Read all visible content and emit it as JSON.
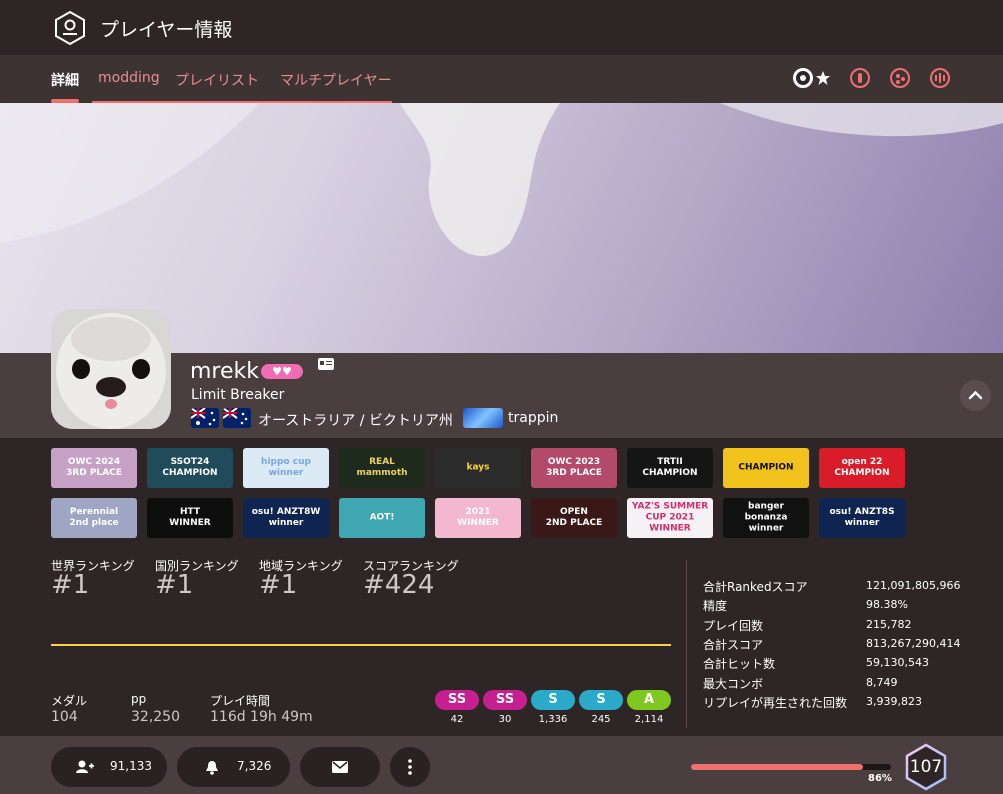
{
  "header": {
    "title": "プレイヤー情報"
  },
  "tabs": [
    {
      "label": "詳細",
      "active": true
    },
    {
      "label": "modding"
    },
    {
      "label": "プレイリスト"
    },
    {
      "label": "マルチプレイヤー"
    }
  ],
  "modes": [
    "osu-standard-icon",
    "taiko-icon",
    "catch-icon",
    "mania-icon"
  ],
  "user": {
    "username": "mrekk",
    "supporter": "♥♥",
    "title": "Limit Breaker",
    "country": "オーストラリア / ビクトリア州",
    "team": "trappin"
  },
  "badges": [
    {
      "text": "OWC 2024\n3RD PLACE",
      "bg": "#c7a0c6",
      "fg": "#fff"
    },
    {
      "text": "SSOT24\nCHAMPION",
      "bg": "#1f4b5a",
      "fg": "#fff"
    },
    {
      "text": "hippo cup\nwinner",
      "bg": "#dbeaf5",
      "fg": "#7aa7d8"
    },
    {
      "text": "REAL\nmammoth",
      "bg": "#1d2a1c",
      "fg": "#e9d26b"
    },
    {
      "text": "kays",
      "bg": "#2b2b2b",
      "fg": "#ffd43a"
    },
    {
      "text": "OWC 2023\n3RD PLACE",
      "bg": "#b44a6a",
      "fg": "#fff"
    },
    {
      "text": "TRTII\nCHAMPION",
      "bg": "#151515",
      "fg": "#fff"
    },
    {
      "text": "CHAMPION",
      "bg": "#f2c21c",
      "fg": "#111"
    },
    {
      "text": "open 22\nCHAMPION",
      "bg": "#d91c2a",
      "fg": "#fff"
    },
    {
      "text": "Perennial\n2nd place",
      "bg": "#9fa6c4",
      "fg": "#fff"
    },
    {
      "text": "HTT\nWINNER",
      "bg": "#0e0e0e",
      "fg": "#fff"
    },
    {
      "text": "osu! ANZT8W\nwinner",
      "bg": "#0f2450",
      "fg": "#fff"
    },
    {
      "text": "AOT!",
      "bg": "#3fa7b2",
      "fg": "#fff"
    },
    {
      "text": "2021\nWINNER",
      "bg": "#f3b7cf",
      "fg": "#fff"
    },
    {
      "text": "OPEN\n2ND PLACE",
      "bg": "#3a1818",
      "fg": "#fff"
    },
    {
      "text": "YAZ'S SUMMER\nCUP 2021\nWINNER",
      "bg": "#f6f1f5",
      "fg": "#d32f6b"
    },
    {
      "text": "banger\nbonanza\nwinner",
      "bg": "#111",
      "fg": "#fff"
    },
    {
      "text": "osu! ANZT8S\nwinner",
      "bg": "#0f2450",
      "fg": "#fff"
    }
  ],
  "ranks": [
    {
      "label": "世界ランキング",
      "value": "#1"
    },
    {
      "label": "国別ランキング",
      "value": "#1"
    },
    {
      "label": "地域ランキング",
      "value": "#1"
    },
    {
      "label": "スコアランキング",
      "value": "#424"
    }
  ],
  "mini": [
    {
      "label": "メダル",
      "value": "104"
    },
    {
      "label": "pp",
      "value": "32,250"
    },
    {
      "label": "プレイ時間",
      "value": "116d 19h 49m"
    }
  ],
  "grades": [
    {
      "label": "SS",
      "count": "42",
      "color": "#c81f90"
    },
    {
      "label": "SS",
      "count": "30",
      "color": "#c81f90"
    },
    {
      "label": "S",
      "count": "1,336",
      "color": "#2aa9c9"
    },
    {
      "label": "S",
      "count": "245",
      "color": "#2aa9c9"
    },
    {
      "label": "A",
      "count": "2,114",
      "color": "#7ec81f"
    }
  ],
  "stats": [
    {
      "label": "合計Rankedスコア",
      "value": "121,091,805,966"
    },
    {
      "label": "精度",
      "value": "98.38%"
    },
    {
      "label": "プレイ回数",
      "value": "215,782"
    },
    {
      "label": "合計スコア",
      "value": "813,267,290,414"
    },
    {
      "label": "合計ヒット数",
      "value": "59,130,543"
    },
    {
      "label": "最大コンボ",
      "value": "8,749"
    },
    {
      "label": "リプレイが再生された回数",
      "value": "3,939,823"
    }
  ],
  "footer": {
    "followers": "91,133",
    "subscribers": "7,326",
    "level_progress": "86%",
    "level_fraction": 0.86,
    "level": "107"
  }
}
